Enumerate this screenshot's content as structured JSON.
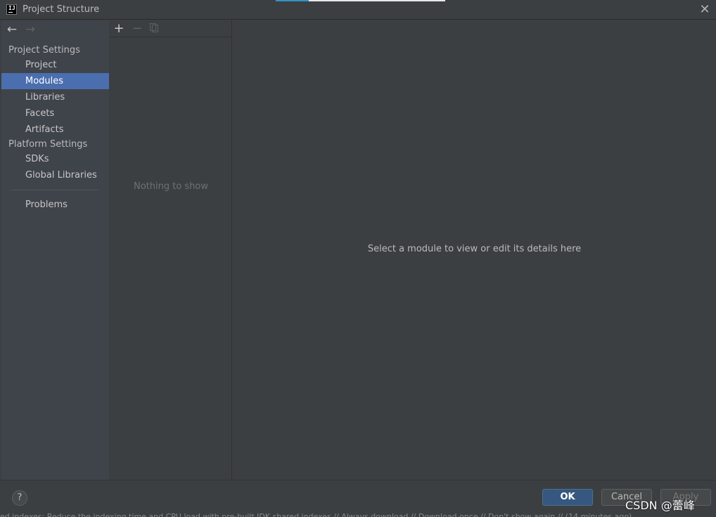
{
  "window": {
    "title": "Project Structure",
    "app_icon_text": "IJ"
  },
  "sidebar": {
    "sections": [
      {
        "header": "Project Settings",
        "items": [
          {
            "label": "Project"
          },
          {
            "label": "Modules",
            "selected": true
          },
          {
            "label": "Libraries"
          },
          {
            "label": "Facets"
          },
          {
            "label": "Artifacts"
          }
        ]
      },
      {
        "header": "Platform Settings",
        "items": [
          {
            "label": "SDKs"
          },
          {
            "label": "Global Libraries"
          }
        ]
      }
    ],
    "problems_label": "Problems"
  },
  "modules_panel": {
    "empty_text": "Nothing to show"
  },
  "details_panel": {
    "hint": "Select a module to view or edit its details here"
  },
  "footer": {
    "help_label": "?",
    "ok_label": "OK",
    "cancel_label": "Cancel",
    "apply_label": "Apply",
    "watermark": "CSDN @蕾峰",
    "status_text": "ed indexes: Reduce the indexing time and CPU load with pre-built JDK shared indexes // Always download // Download once // Don't show again // (14 minutes ago)"
  },
  "colors": {
    "background": "#3c3f41",
    "sidebar_bg": "#3f434a",
    "selection": "#4b6eaf",
    "ok_button": "#365880"
  },
  "icons": {
    "back": "arrow-left-icon",
    "forward": "arrow-right-icon",
    "add": "plus-icon",
    "remove": "minus-icon",
    "copy": "copy-icon",
    "close": "close-icon",
    "help": "help-icon"
  }
}
